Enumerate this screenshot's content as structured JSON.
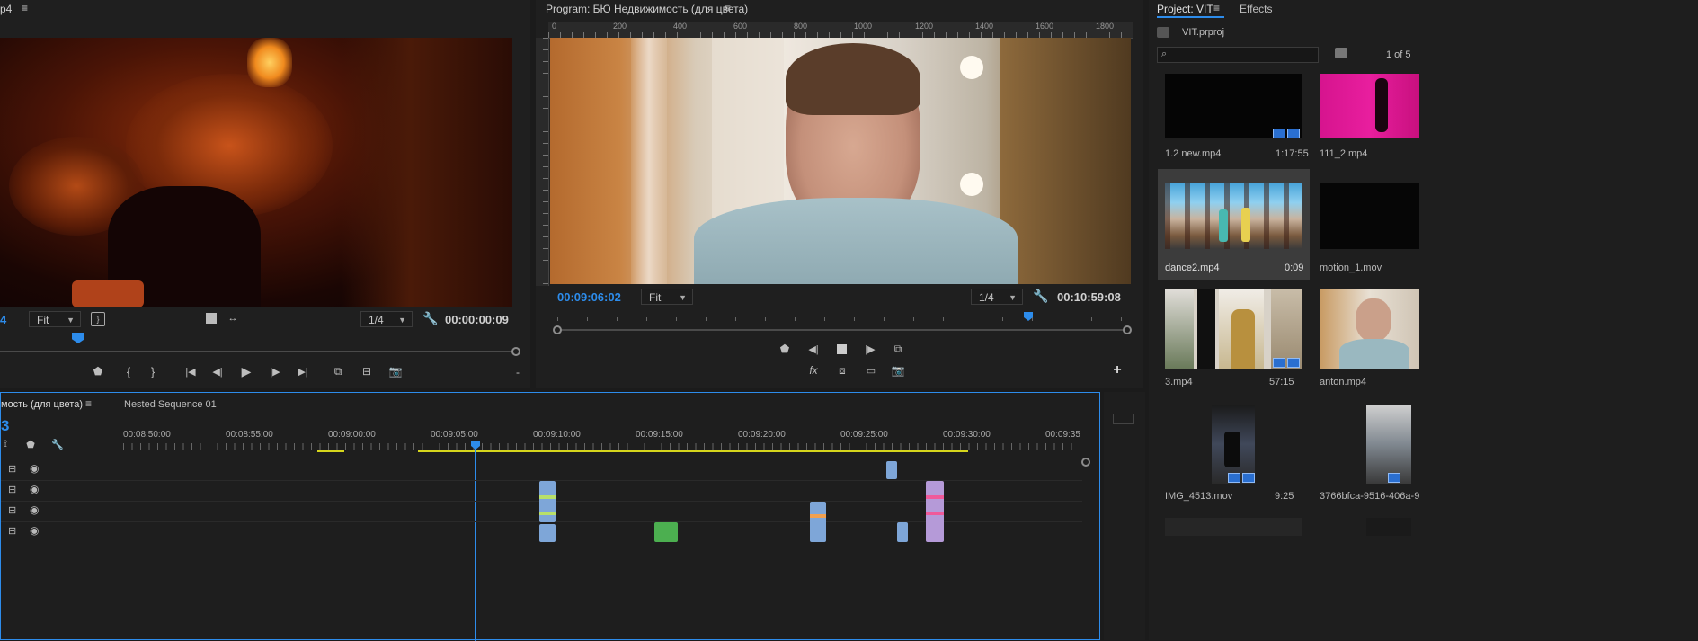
{
  "source_monitor": {
    "title_fragment": "p4",
    "timecode_left": "4",
    "zoom": "Fit",
    "resolution": "1/4",
    "timecode_right": "00:00:00:09"
  },
  "program_monitor": {
    "title": "Program: БЮ Недвижимость (для цвета)",
    "ruler_labels": [
      "0",
      "200",
      "400",
      "600",
      "800",
      "1000",
      "1200",
      "1400",
      "1600",
      "1800"
    ],
    "timecode_left": "00:09:06:02",
    "zoom": "Fit",
    "resolution": "1/4",
    "timecode_right": "00:10:59:08"
  },
  "project": {
    "tab_project": "Project: VIT",
    "tab_effects": "Effects",
    "file_name": "VIT.prproj",
    "search_placeholder": "",
    "count": "1 of 5",
    "items": [
      {
        "name": "1.2 new.mp4",
        "duration": "1:17:55"
      },
      {
        "name": "111_2.mp4",
        "duration": ""
      },
      {
        "name": "dance2.mp4",
        "duration": "0:09"
      },
      {
        "name": "motion_1.mov",
        "duration": ""
      },
      {
        "name": "3.mp4",
        "duration": "57:15"
      },
      {
        "name": "anton.mp4",
        "duration": ""
      },
      {
        "name": "IMG_4513.mov",
        "duration": "9:25"
      },
      {
        "name": "3766bfca-9516-406a-9",
        "duration": ""
      }
    ]
  },
  "timeline": {
    "tab_active": "мость (для цвета)",
    "tab_nested": "Nested Sequence 01",
    "current_tc_fragment": "3",
    "ruler_labels": [
      "00:08:50:00",
      "00:08:55:00",
      "00:09:00:00",
      "00:09:05:00",
      "00:09:10:00",
      "00:09:15:00",
      "00:09:20:00",
      "00:09:25:00",
      "00:09:30:00",
      "00:09:35"
    ]
  },
  "colors": {
    "accent_blue": "#2d8ceb",
    "clip_blue": "#7ea6d8",
    "clip_purple": "#b59ad8",
    "clip_green": "#4caf50",
    "work_area_yellow": "#d6d61c"
  }
}
